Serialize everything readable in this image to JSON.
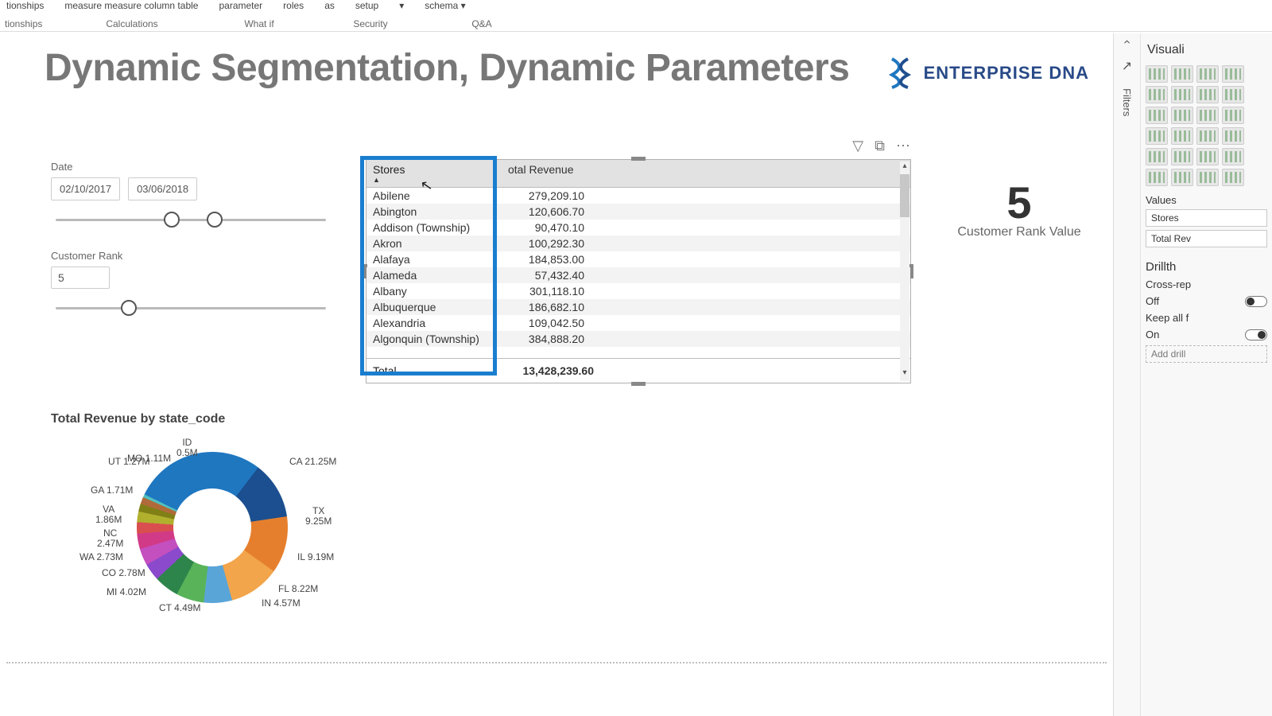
{
  "ribbon": {
    "items": [
      "tionships",
      "measure measure column  table",
      "parameter",
      "roles",
      "as",
      "setup",
      "▾",
      "schema ▾"
    ],
    "groups": [
      "tionships",
      "Calculations",
      "What if",
      "Security",
      "Q&A"
    ]
  },
  "title": "Dynamic Segmentation, Dynamic Parameters",
  "logo": {
    "brand": "ENTERPRISE",
    "strong": "DNA"
  },
  "date_slicer": {
    "label": "Date",
    "from": "02/10/2017",
    "to": "03/06/2018"
  },
  "rank_slicer": {
    "label": "Customer Rank",
    "value": "5"
  },
  "card": {
    "value": "5",
    "label": "Customer Rank Value"
  },
  "table": {
    "headers": {
      "c1": "Stores",
      "c2": "otal Revenue"
    },
    "rows": [
      {
        "c1": "Abilene",
        "c2": "279,209.10"
      },
      {
        "c1": "Abington",
        "c2": "120,606.70"
      },
      {
        "c1": "Addison (Township)",
        "c2": "90,470.10"
      },
      {
        "c1": "Akron",
        "c2": "100,292.30"
      },
      {
        "c1": "Alafaya",
        "c2": "184,853.00"
      },
      {
        "c1": "Alameda",
        "c2": "57,432.40"
      },
      {
        "c1": "Albany",
        "c2": "301,118.10"
      },
      {
        "c1": "Albuquerque",
        "c2": "186,682.10"
      },
      {
        "c1": "Alexandria",
        "c2": "109,042.50"
      },
      {
        "c1": "Algonquin (Township)",
        "c2": "384,888.20"
      }
    ],
    "footer": {
      "c1": "Total",
      "c2": "13,428,239.60"
    }
  },
  "chart_data": {
    "type": "pie",
    "title": "Total Revenue by state_code",
    "series": [
      {
        "name": "Revenue",
        "values": [
          21.25,
          9.25,
          9.19,
          8.22,
          4.57,
          4.49,
          4.02,
          2.78,
          2.73,
          2.47,
          1.86,
          1.71,
          1.27,
          1.11,
          0.5
        ]
      }
    ],
    "categories": [
      "CA",
      "TX",
      "IL",
      "FL",
      "IN",
      "CT",
      "MI",
      "CO",
      "WA",
      "NC",
      "VA",
      "GA",
      "UT",
      "MO",
      "ID"
    ],
    "labels": [
      "CA 21.25M",
      "TX 9.25M",
      "IL 9.19M",
      "FL 8.22M",
      "IN 4.57M",
      "CT 4.49M",
      "MI 4.02M",
      "CO 2.78M",
      "WA 2.73M",
      "NC 2.47M",
      "VA 1.86M",
      "GA 1.71M",
      "UT 1.27M",
      "MO 1.11M",
      "ID 0.5M"
    ]
  },
  "side": {
    "heading": "Visuali",
    "filters_tab": "Filters",
    "values_label": "Values",
    "fields": [
      "Stores",
      "Total Rev"
    ],
    "drill_heading": "Drillth",
    "cross": "Cross-rep",
    "off": "Off",
    "keep": "Keep all f",
    "on": "On",
    "add": "Add drill"
  }
}
